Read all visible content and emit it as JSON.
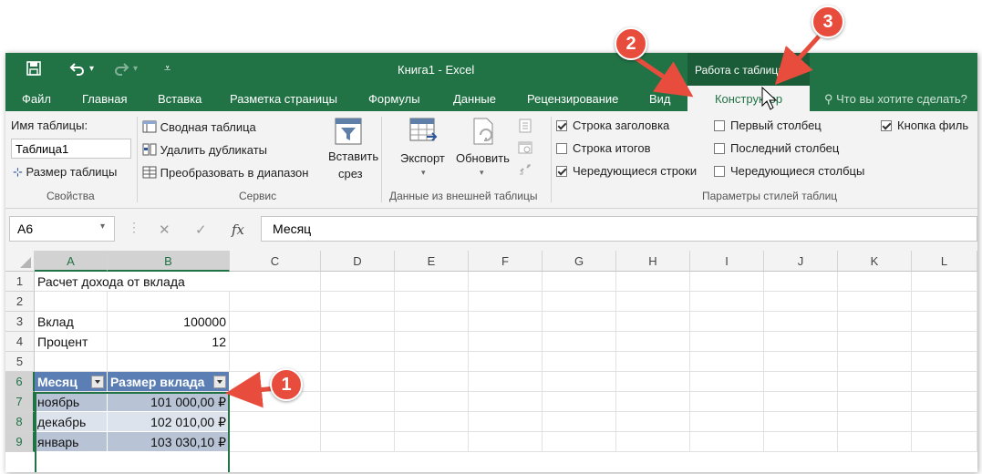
{
  "window": {
    "title": "Книга1 - Excel",
    "context_group": "Работа с таблицами"
  },
  "tabs": [
    "Файл",
    "Главная",
    "Вставка",
    "Разметка страницы",
    "Формулы",
    "Данные",
    "Рецензирование",
    "Вид"
  ],
  "active_tab": "Конструктор",
  "tell_me": "Что вы хотите сделать?",
  "ribbon": {
    "properties": {
      "table_name_label": "Имя таблицы:",
      "table_name_value": "Таблица1",
      "resize": "Размер таблицы",
      "group": "Свойства"
    },
    "tools": {
      "pivot": "Сводная таблица",
      "remove_duplicates": "Удалить дубликаты",
      "convert_to_range": "Преобразовать в диапазон",
      "insert_slicer_1": "Вставить",
      "insert_slicer_2": "срез",
      "group": "Сервис"
    },
    "external": {
      "export": "Экспорт",
      "refresh": "Обновить",
      "group": "Данные из внешней таблицы"
    },
    "style_options": {
      "header_row": "Строка заголовка",
      "total_row": "Строка итогов",
      "banded_rows": "Чередующиеся строки",
      "first_column": "Первый столбец",
      "last_column": "Последний столбец",
      "banded_columns": "Чередующиеся столбцы",
      "filter_button": "Кнопка филь",
      "group": "Параметры стилей таблиц"
    }
  },
  "formula_bar": {
    "name_box": "A6",
    "formula": "Месяц",
    "fx": "fx",
    "cancel": "✕",
    "confirm": "✓"
  },
  "grid": {
    "columns": [
      "A",
      "B",
      "C",
      "D",
      "E",
      "F",
      "G",
      "H",
      "I",
      "J",
      "K",
      "L"
    ],
    "rows": [
      "1",
      "2",
      "3",
      "4",
      "5",
      "6",
      "7",
      "8",
      "9"
    ],
    "cells": {
      "a1": "Расчет дохода от вклада",
      "a3": "Вклад",
      "b3": "100000",
      "a4": "Процент",
      "b4": "12",
      "a6": "Месяц",
      "b6": "Размер вклада",
      "a7": "ноябрь",
      "b7": "101 000,00 ₽",
      "a8": "декабрь",
      "b8": "102 010,00 ₽",
      "a9": "январь",
      "b9": "103 030,10 ₽"
    }
  },
  "annotations": [
    "1",
    "2",
    "3"
  ],
  "colors": {
    "excel_green": "#217346",
    "table_header": "#5b7fb4",
    "table_band": "#b8c4d6",
    "annotation_red": "#e84c3d"
  }
}
